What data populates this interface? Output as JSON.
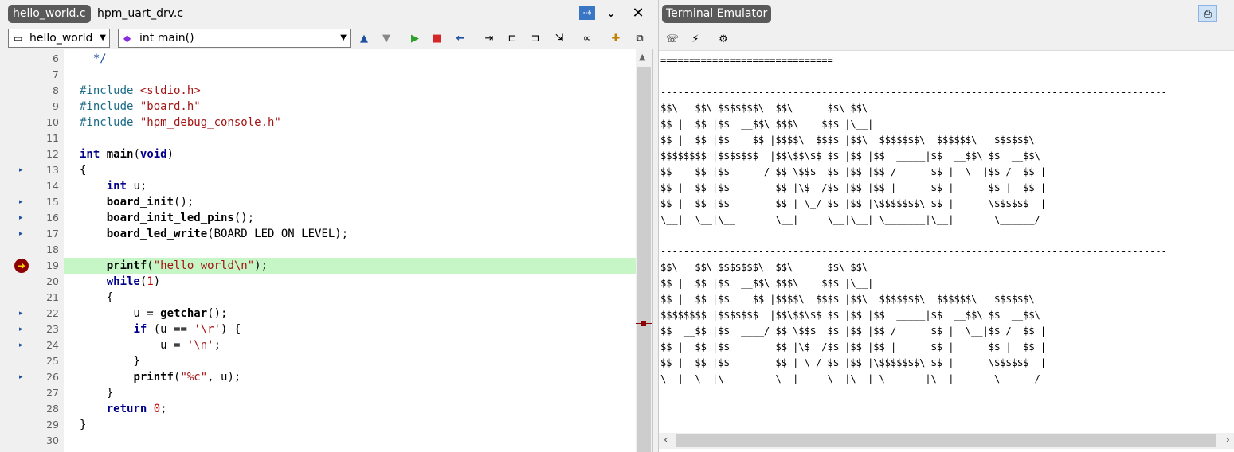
{
  "editor": {
    "tabs": [
      {
        "label": "hello_world.c",
        "active": true
      },
      {
        "label": "hpm_uart_drv.c",
        "active": false
      }
    ],
    "project_combo": "hello_world",
    "function_combo": "int main()",
    "lines": [
      {
        "num": "6",
        "marker": false,
        "fold": "",
        "tokens": [
          [
            "cm",
            "  */"
          ]
        ]
      },
      {
        "num": "7",
        "marker": false,
        "fold": "",
        "tokens": []
      },
      {
        "num": "8",
        "marker": false,
        "fold": "",
        "tokens": [
          [
            "pp",
            "#include "
          ],
          [
            "str",
            "<stdio.h>"
          ]
        ]
      },
      {
        "num": "9",
        "marker": false,
        "fold": "",
        "tokens": [
          [
            "pp",
            "#include "
          ],
          [
            "str",
            "\"board.h\""
          ]
        ]
      },
      {
        "num": "10",
        "marker": false,
        "fold": "",
        "tokens": [
          [
            "pp",
            "#include "
          ],
          [
            "str",
            "\"hpm_debug_console.h\""
          ]
        ]
      },
      {
        "num": "11",
        "marker": false,
        "fold": "",
        "tokens": []
      },
      {
        "num": "12",
        "marker": false,
        "fold": "",
        "tokens": [
          [
            "kw",
            "int"
          ],
          [
            "fn",
            " main"
          ],
          [
            "",
            "("
          ],
          [
            "kw",
            "void"
          ],
          [
            "",
            ")"
          ]
        ]
      },
      {
        "num": "13",
        "marker": true,
        "fold": "box",
        "tokens": [
          [
            "",
            "{"
          ]
        ]
      },
      {
        "num": "14",
        "marker": false,
        "fold": "",
        "tokens": [
          [
            "",
            "    "
          ],
          [
            "kw",
            "int"
          ],
          [
            "",
            " u;"
          ]
        ]
      },
      {
        "num": "15",
        "marker": true,
        "fold": "",
        "tokens": [
          [
            "",
            "    "
          ],
          [
            "fn",
            "board_init"
          ],
          [
            "",
            "();"
          ]
        ]
      },
      {
        "num": "16",
        "marker": true,
        "fold": "",
        "tokens": [
          [
            "",
            "    "
          ],
          [
            "fn",
            "board_init_led_pins"
          ],
          [
            "",
            "();"
          ]
        ]
      },
      {
        "num": "17",
        "marker": true,
        "fold": "",
        "tokens": [
          [
            "",
            "    "
          ],
          [
            "fn",
            "board_led_write"
          ],
          [
            "",
            "(BOARD_LED_ON_LEVEL);"
          ]
        ]
      },
      {
        "num": "18",
        "marker": false,
        "fold": "",
        "tokens": []
      },
      {
        "num": "19",
        "marker": false,
        "fold": "",
        "current": true,
        "tokens": [
          [
            "",
            "    "
          ],
          [
            "fn",
            "printf"
          ],
          [
            "",
            "("
          ],
          [
            "str",
            "\"hello world\\n\""
          ],
          [
            "",
            ");"
          ]
        ]
      },
      {
        "num": "20",
        "marker": false,
        "fold": "",
        "tokens": [
          [
            "",
            "    "
          ],
          [
            "kw",
            "while"
          ],
          [
            "",
            "("
          ],
          [
            "num",
            "1"
          ],
          [
            "",
            ")"
          ]
        ]
      },
      {
        "num": "21",
        "marker": false,
        "fold": "box",
        "tokens": [
          [
            "",
            "    {"
          ]
        ]
      },
      {
        "num": "22",
        "marker": true,
        "fold": "",
        "tokens": [
          [
            "",
            "        u = "
          ],
          [
            "fn",
            "getchar"
          ],
          [
            "",
            "();"
          ]
        ]
      },
      {
        "num": "23",
        "marker": true,
        "fold": "box",
        "tokens": [
          [
            "",
            "        "
          ],
          [
            "kw",
            "if"
          ],
          [
            "",
            " (u == "
          ],
          [
            "str",
            "'\\r'"
          ],
          [
            "",
            ") {"
          ]
        ]
      },
      {
        "num": "24",
        "marker": true,
        "fold": "",
        "tokens": [
          [
            "",
            "            u = "
          ],
          [
            "str",
            "'\\n'"
          ],
          [
            "",
            ";"
          ]
        ]
      },
      {
        "num": "25",
        "marker": false,
        "fold": "end",
        "tokens": [
          [
            "",
            "        }"
          ]
        ]
      },
      {
        "num": "26",
        "marker": true,
        "fold": "",
        "tokens": [
          [
            "",
            "        "
          ],
          [
            "fn",
            "printf"
          ],
          [
            "",
            "("
          ],
          [
            "str",
            "\"%c\""
          ],
          [
            "",
            ", u);"
          ]
        ]
      },
      {
        "num": "27",
        "marker": false,
        "fold": "end",
        "tokens": [
          [
            "",
            "    }"
          ]
        ]
      },
      {
        "num": "28",
        "marker": false,
        "fold": "",
        "tokens": [
          [
            "",
            "    "
          ],
          [
            "kw",
            "return"
          ],
          [
            "",
            " "
          ],
          [
            "num",
            "0"
          ],
          [
            "",
            ";"
          ]
        ]
      },
      {
        "num": "29",
        "marker": false,
        "fold": "end",
        "tokens": [
          [
            "",
            "}"
          ]
        ]
      },
      {
        "num": "30",
        "marker": false,
        "fold": "",
        "tokens": []
      }
    ]
  },
  "terminal": {
    "title": "Terminal Emulator",
    "lines": [
      "==============================",
      "",
      "----------------------------------------------------------------------------------------",
      "$$\\   $$\\ $$$$$$$\\  $$\\      $$\\ $$\\",
      "$$ |  $$ |$$  __$$\\ $$$\\    $$$ |\\__|",
      "$$ |  $$ |$$ |  $$ |$$$$\\  $$$$ |$$\\  $$$$$$$\\  $$$$$$\\   $$$$$$\\",
      "$$$$$$$$ |$$$$$$$  |$$\\$$\\$$ $$ |$$ |$$  _____|$$  __$$\\ $$  __$$\\",
      "$$  __$$ |$$  ____/ $$ \\$$$  $$ |$$ |$$ /      $$ |  \\__|$$ /  $$ |",
      "$$ |  $$ |$$ |      $$ |\\$  /$$ |$$ |$$ |      $$ |      $$ |  $$ |",
      "$$ |  $$ |$$ |      $$ | \\_/ $$ |$$ |\\$$$$$$$\\ $$ |      \\$$$$$$  |",
      "\\__|  \\__|\\__|      \\__|     \\__|\\__| \\_______|\\__|       \\______/",
      "-",
      "----------------------------------------------------------------------------------------",
      "$$\\   $$\\ $$$$$$$\\  $$\\      $$\\ $$\\",
      "$$ |  $$ |$$  __$$\\ $$$\\    $$$ |\\__|",
      "$$ |  $$ |$$ |  $$ |$$$$\\  $$$$ |$$\\  $$$$$$$\\  $$$$$$\\   $$$$$$\\",
      "$$$$$$$$ |$$$$$$$  |$$\\$$\\$$ $$ |$$ |$$  _____|$$  __$$\\ $$  __$$\\",
      "$$  __$$ |$$  ____/ $$ \\$$$  $$ |$$ |$$ /      $$ |  \\__|$$ /  $$ |",
      "$$ |  $$ |$$ |      $$ |\\$  /$$ |$$ |$$ |      $$ |      $$ |  $$ |",
      "$$ |  $$ |$$ |      $$ | \\_/ $$ |$$ |\\$$$$$$$\\ $$ |      \\$$$$$$  |",
      "\\__|  \\__|\\__|      \\__|     \\__|\\__| \\_______|\\__|       \\______/",
      "----------------------------------------------------------------------------------------"
    ]
  },
  "colors": {
    "current_line": "#c6f5c6",
    "keyword": "#00008b",
    "string": "#a31515",
    "tab_active_bg": "#5a5a5a"
  }
}
